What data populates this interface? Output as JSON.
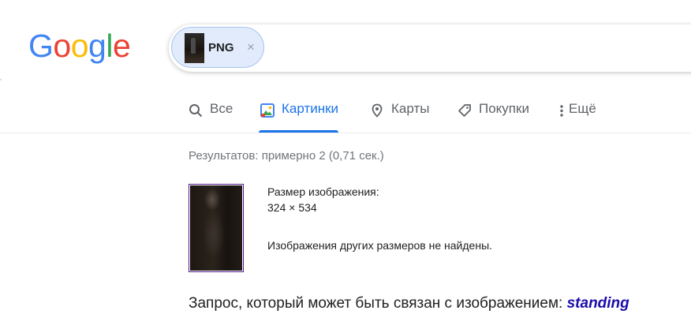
{
  "logo": {
    "letters": [
      "G",
      "o",
      "o",
      "g",
      "l",
      "e"
    ],
    "colors": [
      "#4285F4",
      "#EA4335",
      "#FBBC05",
      "#4285F4",
      "#34A853",
      "#EA4335"
    ]
  },
  "search": {
    "chip_label": "PNG",
    "chip_close": "×"
  },
  "tabs": [
    {
      "label": "Все",
      "icon": "search-icon"
    },
    {
      "label": "Картинки",
      "icon": "images-icon",
      "active": true
    },
    {
      "label": "Карты",
      "icon": "map-pin-icon"
    },
    {
      "label": "Покупки",
      "icon": "tag-icon"
    },
    {
      "label": "Ещё",
      "icon": "more-vert-icon"
    }
  ],
  "results": {
    "stats": "Результатов: примерно 2 (0,71 сек.)",
    "size_label": "Размер изображения:",
    "size_value": "324 × 534",
    "no_other_sizes": "Изображения других размеров не найдены.",
    "query_prefix": "Запрос, который может быть связан с изображением:",
    "query_link": "standing"
  },
  "colors": {
    "accent": "#1a73e8",
    "link": "#1a0dab",
    "chip_bg": "#e1ebfb"
  }
}
